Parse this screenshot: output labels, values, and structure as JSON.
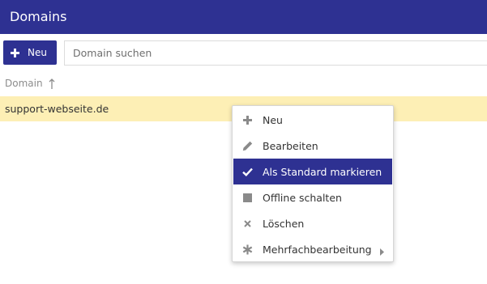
{
  "header": {
    "title": "Domains"
  },
  "toolbar": {
    "new_label": "Neu",
    "search_placeholder": "Domain suchen",
    "icon": "plus-icon"
  },
  "table": {
    "columns": [
      {
        "label": "Domain",
        "sort": "ascending",
        "icon": "sort-arrow-up-icon"
      }
    ],
    "rows": [
      {
        "domain": "support-webseite.de",
        "selected": true
      }
    ]
  },
  "context_menu": {
    "items": [
      {
        "label": "Neu",
        "icon": "plus-icon"
      },
      {
        "label": "Bearbeiten",
        "icon": "pencil-icon"
      },
      {
        "label": "Als Standard markieren",
        "icon": "checkmark-icon",
        "highlighted": true
      },
      {
        "label": "Offline schalten",
        "icon": "stop-square-icon"
      },
      {
        "label": "Löschen",
        "icon": "close-x-icon"
      },
      {
        "label": "Mehrfachbearbeitung",
        "icon": "asterisk-icon",
        "submenu": true
      }
    ]
  },
  "colors": {
    "accent": "#2e3192",
    "selected_row": "#fdefb5",
    "menu_icon": "#8a8a8a"
  }
}
